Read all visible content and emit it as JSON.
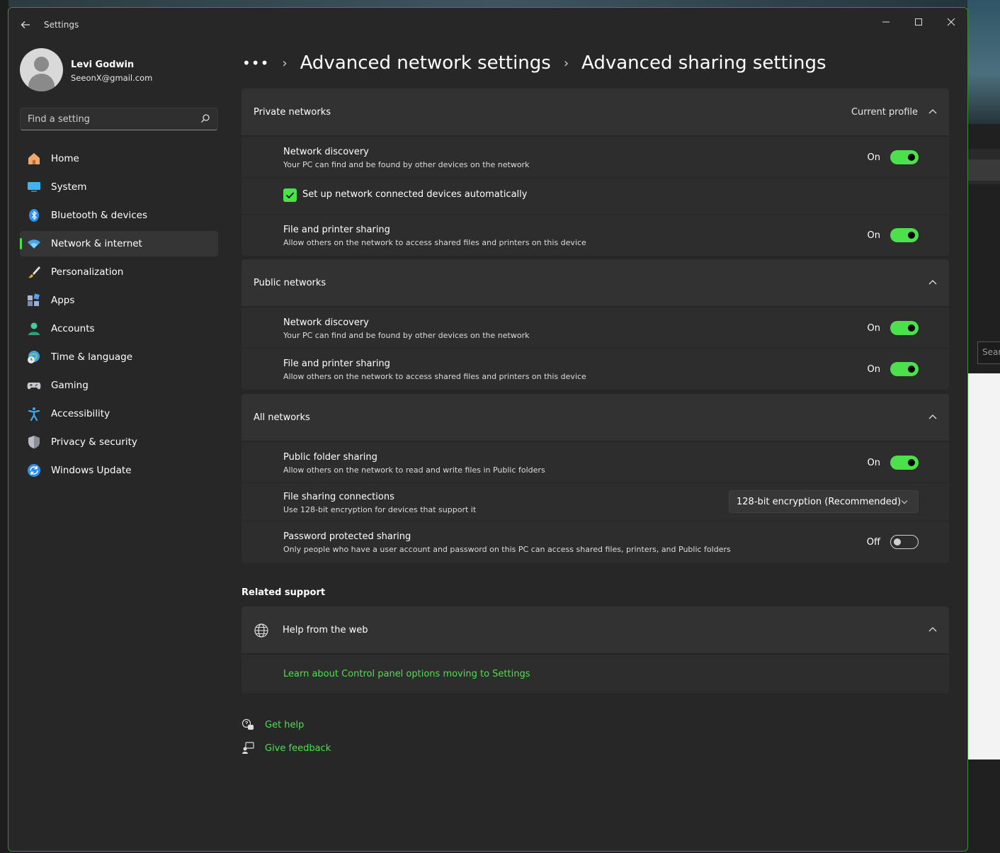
{
  "window": {
    "app_title": "Settings",
    "controls": {
      "minimize": "—",
      "maximize": "☐",
      "close": "✕"
    }
  },
  "profile": {
    "name": "Levi Godwin",
    "email": "SeeonX@gmail.com"
  },
  "search": {
    "placeholder": "Find a setting"
  },
  "nav": {
    "items": [
      {
        "label": "Home",
        "icon": "home-icon"
      },
      {
        "label": "System",
        "icon": "system-icon"
      },
      {
        "label": "Bluetooth & devices",
        "icon": "bluetooth-icon"
      },
      {
        "label": "Network & internet",
        "icon": "wifi-icon",
        "active": true
      },
      {
        "label": "Personalization",
        "icon": "brush-icon"
      },
      {
        "label": "Apps",
        "icon": "apps-icon"
      },
      {
        "label": "Accounts",
        "icon": "accounts-icon"
      },
      {
        "label": "Time & language",
        "icon": "clock-globe-icon"
      },
      {
        "label": "Gaming",
        "icon": "gamepad-icon"
      },
      {
        "label": "Accessibility",
        "icon": "accessibility-icon"
      },
      {
        "label": "Privacy & security",
        "icon": "shield-icon"
      },
      {
        "label": "Windows Update",
        "icon": "update-icon"
      }
    ]
  },
  "breadcrumb": {
    "dots": "•••",
    "items": [
      "Advanced network settings",
      "Advanced sharing settings"
    ]
  },
  "private_networks": {
    "title": "Private networks",
    "badge": "Current profile",
    "network_discovery": {
      "title": "Network discovery",
      "desc": "Your PC can find and be found by other devices on the network",
      "state": "On"
    },
    "auto_setup": {
      "label": "Set up network connected devices automatically"
    },
    "file_printer": {
      "title": "File and printer sharing",
      "desc": "Allow others on the network to access shared files and printers on this device",
      "state": "On"
    }
  },
  "public_networks": {
    "title": "Public networks",
    "network_discovery": {
      "title": "Network discovery",
      "desc": "Your PC can find and be found by other devices on the network",
      "state": "On"
    },
    "file_printer": {
      "title": "File and printer sharing",
      "desc": "Allow others on the network to access shared files and printers on this device",
      "state": "On"
    }
  },
  "all_networks": {
    "title": "All networks",
    "public_folder": {
      "title": "Public folder sharing",
      "desc": "Allow others on the network to read and write files in Public folders",
      "state": "On"
    },
    "file_sharing_conn": {
      "title": "File sharing connections",
      "desc": "Use 128-bit encryption for devices that support it",
      "selected": "128-bit encryption (Recommended)"
    },
    "password_sharing": {
      "title": "Password protected sharing",
      "desc": "Only people who have a user account and password on this PC can access shared files, printers, and Public folders",
      "state": "Off"
    }
  },
  "related_support": {
    "title": "Related support",
    "help_web": "Help from the web",
    "link": "Learn about Control panel options moving to Settings"
  },
  "footer": {
    "get_help": "Get help",
    "give_feedback": "Give feedback"
  },
  "desktop": {
    "search_fragment": "Sear"
  },
  "colors": {
    "accent": "#4ce04c",
    "background": "#272727",
    "card": "#2d2d2d"
  }
}
